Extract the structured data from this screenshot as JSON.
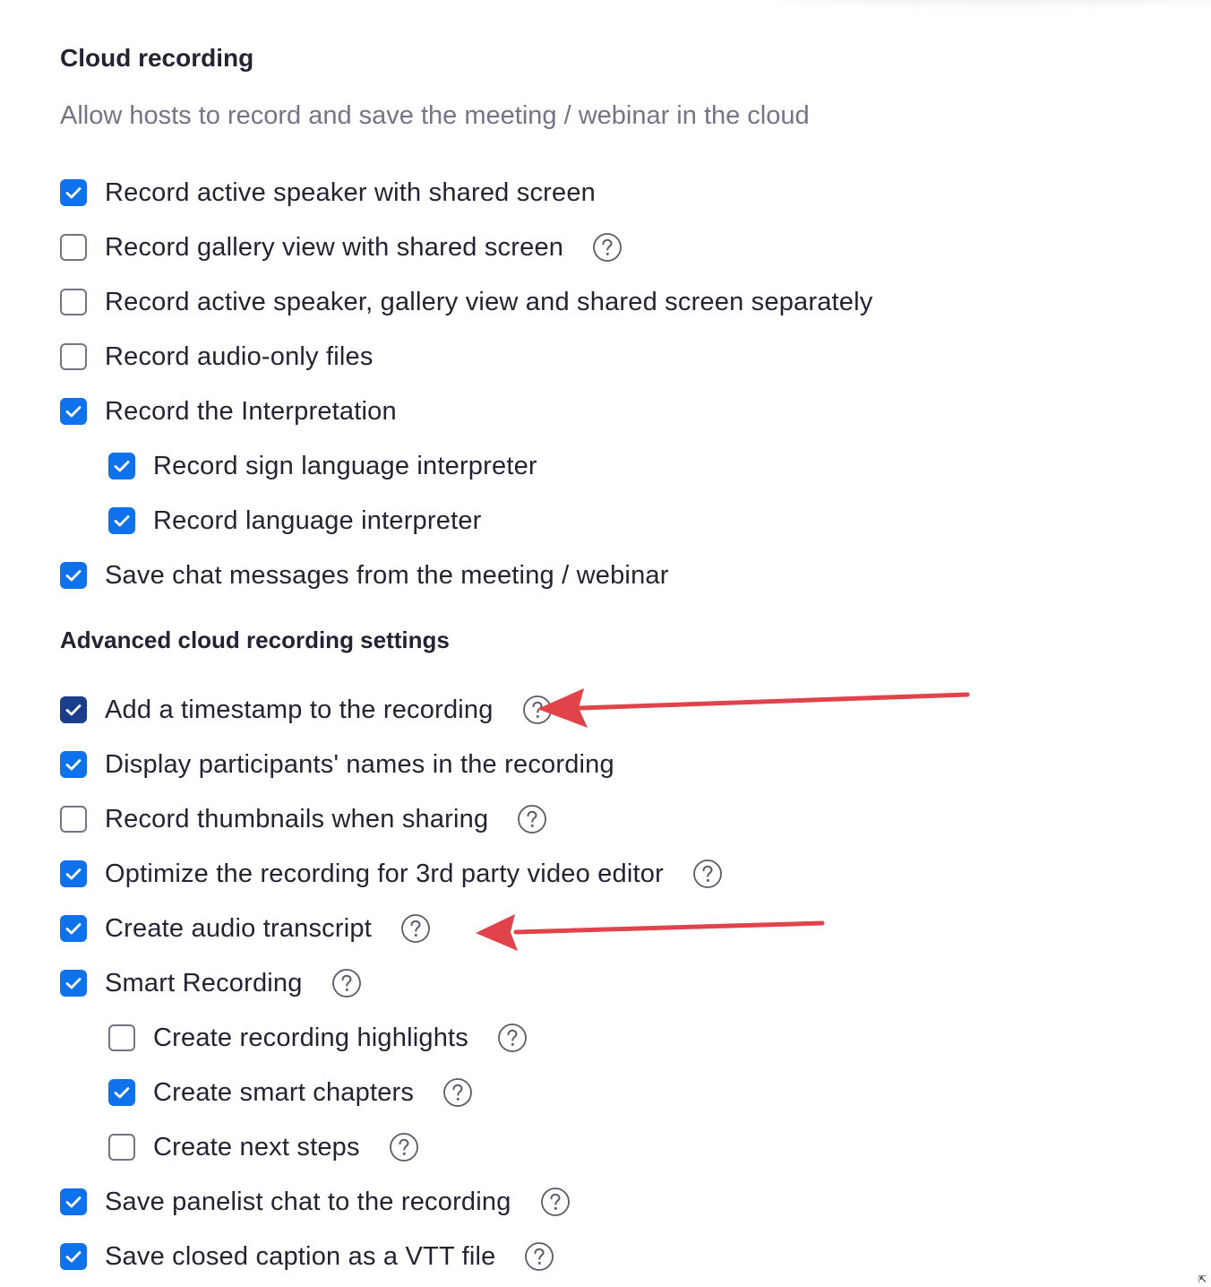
{
  "cloud_recording": {
    "title": "Cloud recording",
    "description": "Allow hosts to record and save the meeting / webinar in the cloud",
    "options": [
      {
        "label": "Record active speaker with shared screen",
        "checked": true,
        "help": false
      },
      {
        "label": "Record gallery view with shared screen",
        "checked": false,
        "help": true
      },
      {
        "label": "Record active speaker, gallery view and shared screen separately",
        "checked": false,
        "help": false
      },
      {
        "label": "Record audio-only files",
        "checked": false,
        "help": false
      },
      {
        "label": "Record the Interpretation",
        "checked": true,
        "help": false
      },
      {
        "label": "Record sign language interpreter",
        "checked": true,
        "help": false
      },
      {
        "label": "Record language interpreter",
        "checked": true,
        "help": false
      },
      {
        "label": "Save chat messages from the meeting / webinar",
        "checked": true,
        "help": false
      }
    ]
  },
  "advanced": {
    "title": "Advanced cloud recording settings",
    "options": [
      {
        "label": "Add a timestamp to the recording",
        "checked": true,
        "help": true,
        "focused": true
      },
      {
        "label": "Display participants' names in the recording",
        "checked": true,
        "help": false
      },
      {
        "label": "Record thumbnails when sharing",
        "checked": false,
        "help": true
      },
      {
        "label": "Optimize the recording for 3rd party video editor",
        "checked": true,
        "help": true
      },
      {
        "label": "Create audio transcript",
        "checked": true,
        "help": true
      },
      {
        "label": "Smart Recording",
        "checked": true,
        "help": true
      },
      {
        "label": "Create recording highlights",
        "checked": false,
        "help": true
      },
      {
        "label": "Create smart chapters",
        "checked": true,
        "help": true
      },
      {
        "label": "Create next steps",
        "checked": false,
        "help": true
      },
      {
        "label": "Save panelist chat to the recording",
        "checked": true,
        "help": true
      },
      {
        "label": "Save closed caption as a VTT file",
        "checked": true,
        "help": true
      }
    ]
  },
  "icons": {
    "checkbox_checked": "checkmark-icon",
    "help": "question-circle-icon",
    "annotation": "red-arrow-annotation",
    "corner": "resize-cursor-icon"
  },
  "colors": {
    "checkbox_blue": "#0e72ed",
    "checkbox_focused": "#1a3e8c",
    "unchecked_border": "#747487",
    "text": "#232333",
    "muted_text": "#747487",
    "arrow_red": "#e0434a"
  }
}
